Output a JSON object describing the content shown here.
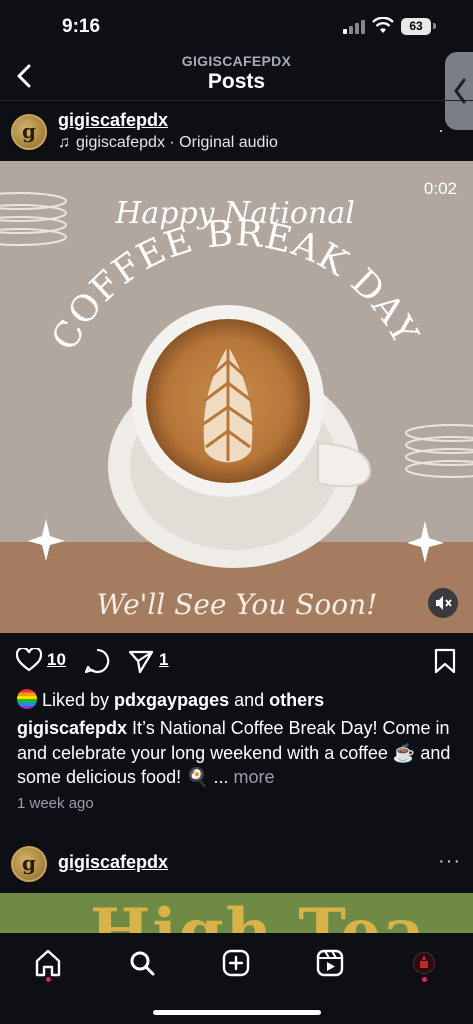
{
  "status": {
    "time": "9:16",
    "battery": "63"
  },
  "header": {
    "account": "GIGISCAFEPDX",
    "title": "Posts"
  },
  "post": {
    "username": "gigiscafepdx",
    "audio_user": "gigiscafepdx",
    "audio_sep": " · ",
    "audio_label": "Original audio",
    "video_timer": "0:02",
    "art": {
      "line1": "Happy National",
      "line2": "COFFEE BREAK DAY",
      "line3": "We'll See You Soon!"
    },
    "likes_count": "10",
    "shares_count": "1",
    "liked_by_prefix": "Liked by ",
    "liked_by_user": "pdxgaypages",
    "liked_by_and": " and ",
    "liked_by_others": "others",
    "caption_user": "gigiscafepdx",
    "caption_text": "It’s National Coffee Break Day! Come in and celebrate your long weekend with a coffee ☕ and some delicious food! 🍳 ... ",
    "caption_more": "more",
    "time_ago": "1 week ago"
  },
  "post2": {
    "username": "gigiscafepdx",
    "title_partial": "High Tea"
  },
  "icons": {
    "back": "chevron-left-icon",
    "like": "heart-icon",
    "comment": "comment-icon",
    "share": "send-icon",
    "save": "bookmark-icon",
    "mute": "speaker-muted-icon",
    "home": "home-icon",
    "search": "search-icon",
    "create": "plus-square-icon",
    "reels": "reels-icon",
    "profile": "profile-avatar-icon"
  },
  "colors": {
    "background": "#0d0f14",
    "media_bg": "#b1a79e",
    "band": "#a47c5f",
    "notification_dot": "#e0245e"
  }
}
